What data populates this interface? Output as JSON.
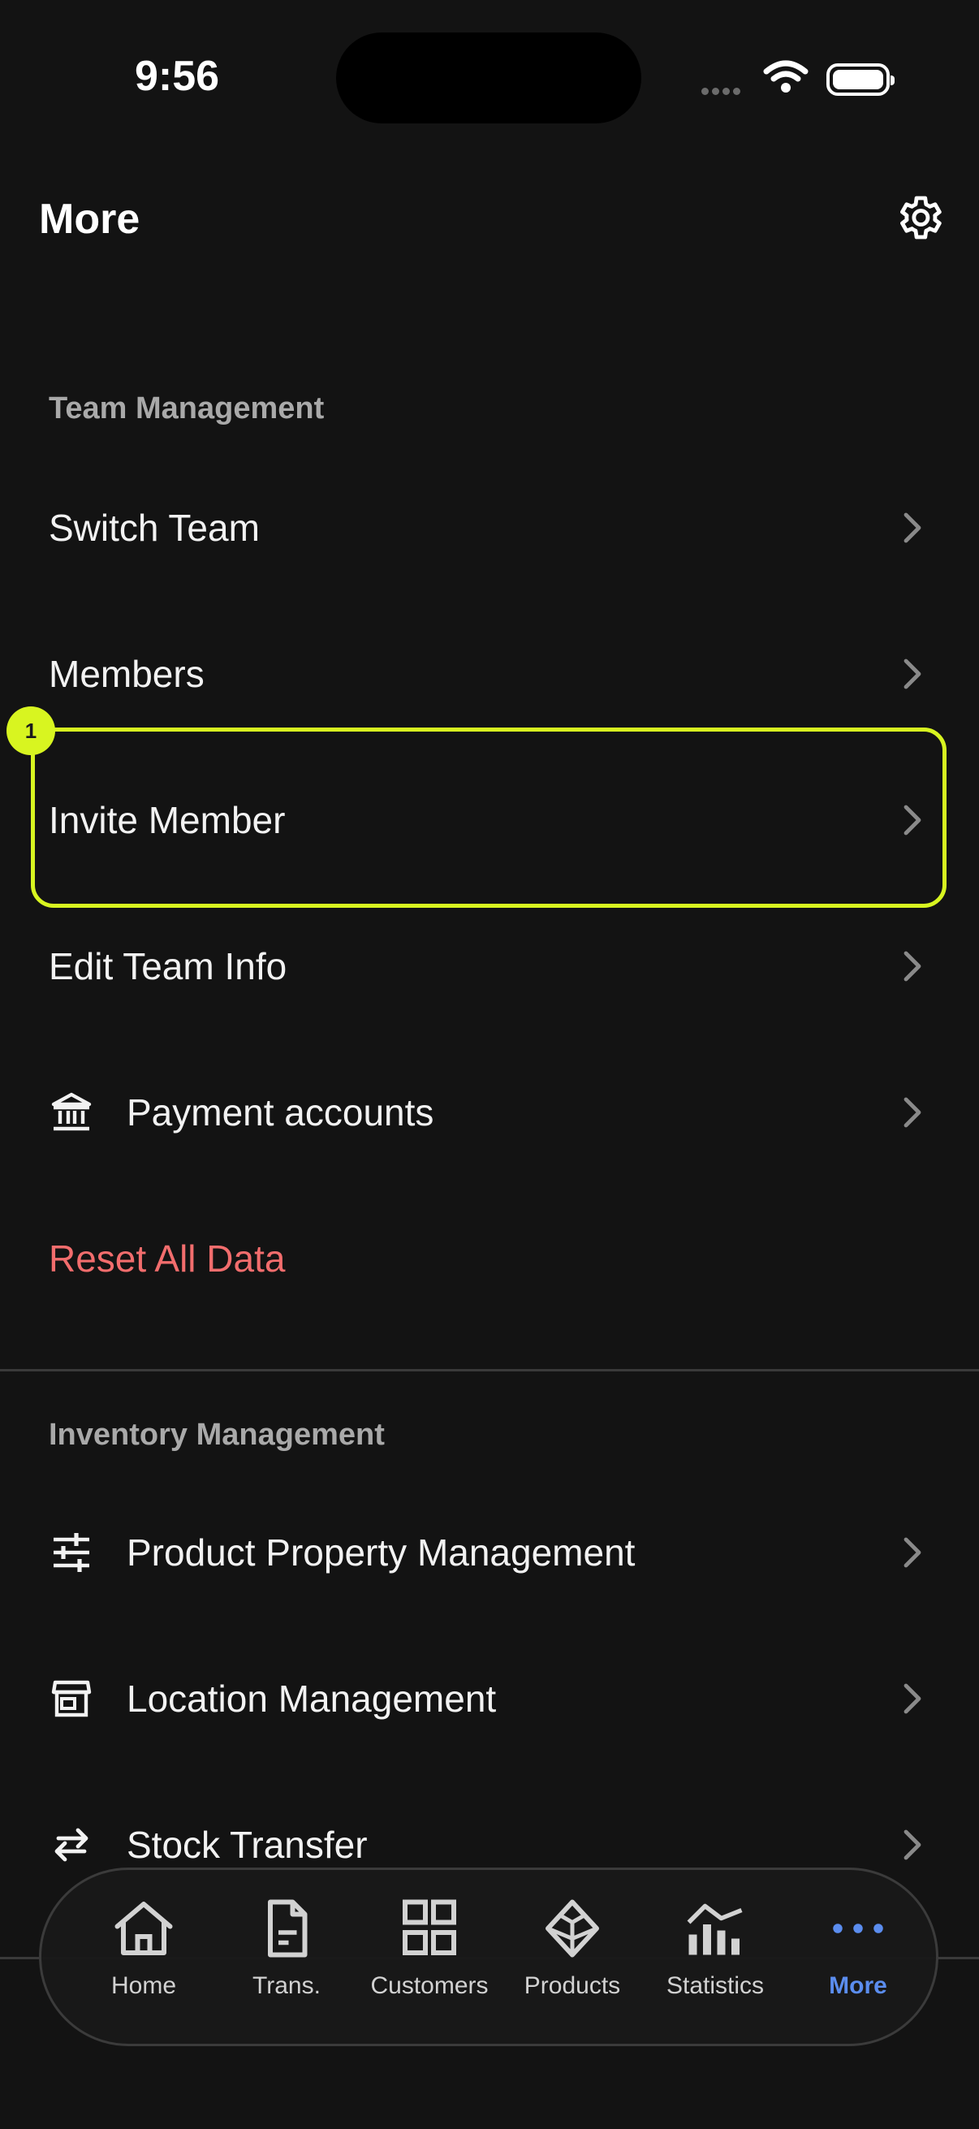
{
  "status_bar": {
    "time": "9:56"
  },
  "header": {
    "title": "More"
  },
  "sections": {
    "team_management": {
      "header": "Team Management",
      "switch_team": "Switch Team",
      "members": "Members",
      "invite_member": "Invite Member",
      "edit_team_info": "Edit Team Info",
      "payment_accounts": "Payment accounts",
      "reset_all_data": "Reset All Data"
    },
    "inventory_management": {
      "header": "Inventory Management",
      "product_property_management": "Product Property Management",
      "location_management": "Location Management",
      "stock_transfer": "Stock Transfer"
    }
  },
  "annotation": {
    "marker_label": "1",
    "color": "#d8f520"
  },
  "tabbar": {
    "home": "Home",
    "transactions": "Trans.",
    "customers": "Customers",
    "products": "Products",
    "statistics": "Statistics",
    "more": "More"
  },
  "colors": {
    "background": "#131313",
    "danger": "#f26d6d",
    "active_tab": "#5b8def"
  }
}
